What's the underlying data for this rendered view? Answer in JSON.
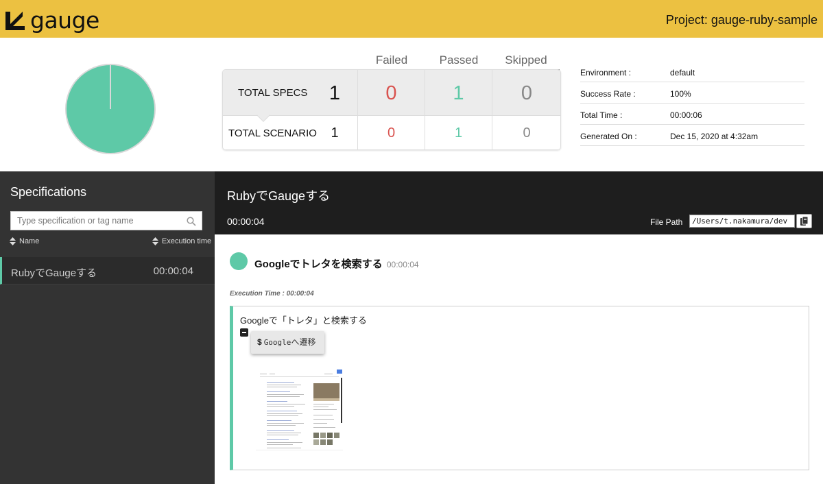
{
  "header": {
    "logo_text": "gauge",
    "project": "Project: gauge-ruby-sample",
    "brand_color": "#ecc141"
  },
  "summary": {
    "columns": [
      {
        "label": "Failed",
        "color": "#d9534f"
      },
      {
        "label": "Passed",
        "color": "#5ec9a7"
      },
      {
        "label": "Skipped",
        "color": "#888888"
      }
    ],
    "specs": {
      "label": "TOTAL SPECS",
      "total": "1",
      "failed": "0",
      "passed": "1",
      "skipped": "0"
    },
    "scenarios": {
      "label": "TOTAL SCENARIO",
      "total": "1",
      "failed": "0",
      "passed": "1",
      "skipped": "0"
    },
    "pie": {
      "passed": 1,
      "failed": 0,
      "skipped": 0
    }
  },
  "environment": {
    "rows": [
      {
        "key": "Environment :",
        "value": "default"
      },
      {
        "key": "Success Rate :",
        "value": "100%"
      },
      {
        "key": "Total Time :",
        "value": "00:00:06"
      },
      {
        "key": "Generated On :",
        "value": "Dec 15, 2020 at 4:32am"
      }
    ]
  },
  "sidebar": {
    "title": "Specifications",
    "search_placeholder": "Type specification or tag name",
    "sort_name": "Name",
    "sort_time": "Execution time",
    "items": [
      {
        "name": "RubyでGaugeする",
        "time": "00:00:04",
        "status": "passed"
      }
    ]
  },
  "spec": {
    "title": "RubyでGaugeする",
    "duration": "00:00:04",
    "file_path_label": "File Path",
    "file_path": "/Users/t.nakamura/dev"
  },
  "scenario": {
    "title": "Googleでトレタを検索する",
    "time": "00:00:04",
    "exec_time": "Execution Time : 00:00:04",
    "status_color": "#5ec9a7",
    "step": {
      "text": "Googleで「トレタ」と検索する",
      "cmd_prefix": "$",
      "cmd_mono": "Google",
      "cmd_rest": "へ遷移"
    }
  }
}
